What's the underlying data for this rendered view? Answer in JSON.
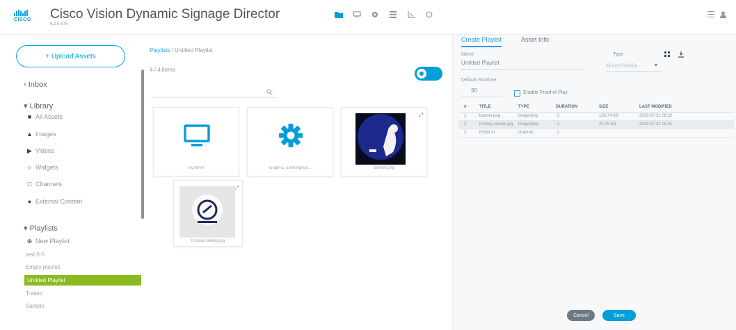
{
  "header": {
    "brand": "CISCO",
    "title": "Cisco Vision Dynamic Signage Director",
    "version": "6.2.0-578",
    "nav_icons": [
      "folder-icon",
      "monitor-icon",
      "gear-icon",
      "list-icon",
      "chart-icon",
      "circle-icon"
    ],
    "right_icons": [
      "menu-icon",
      "user-icon"
    ]
  },
  "sidebar": {
    "upload_label": "+ Upload Assets",
    "inbox": "Inbox",
    "library": "Library",
    "library_items": [
      {
        "icon": "document-icon",
        "label": "All Assets"
      },
      {
        "icon": "image-icon",
        "label": "Images"
      },
      {
        "icon": "video-icon",
        "label": "Videos"
      },
      {
        "icon": "widget-icon",
        "label": "Widgets"
      },
      {
        "icon": "channel-icon",
        "label": "Channels"
      },
      {
        "icon": "external-icon",
        "label": "External Content"
      }
    ],
    "playlists": "Playlists",
    "new_playlist": "New Playlist",
    "playlist_items": [
      "test-5-6",
      "Empty playlist",
      "Untitled Playlist",
      "T-stem",
      "Sample"
    ],
    "active_index": 2
  },
  "middle": {
    "breadcrumb_link": "Playlists",
    "breadcrumb_sep": "/",
    "breadcrumb_current": "Untitled Playlist",
    "count": "4 / 4 items",
    "cards": [
      {
        "caption": "HDMI-In",
        "kind": "monitor"
      },
      {
        "caption": "Graphic_user0riginal...",
        "kind": "gear"
      },
      {
        "caption": "banner.png",
        "kind": "photo"
      },
      {
        "caption": "hockey-sleepe.jpg",
        "kind": "logo"
      }
    ]
  },
  "right": {
    "tabs": [
      "Create Playlist",
      "Asset Info"
    ],
    "active_tab": 0,
    "name_label": "Name",
    "name_value": "Untitled Playlist",
    "type_label": "Type",
    "type_value": "Mixed Media",
    "default_runtime_label": "Default Runtime",
    "default_runtime_value": "30",
    "proof_of_play_label": "Enable Proof of Play",
    "table": {
      "headers": [
        "#",
        "TITLE",
        "TYPE",
        "DURATION",
        "SIZE",
        "LAST MODIFIED"
      ],
      "rows": [
        [
          "1",
          "banner.png",
          "image/png",
          "-1",
          "150.74 KB",
          "2019-07-31 08:22"
        ],
        [
          "2",
          "hockey-sleepe.jpg",
          "image/jpeg",
          "-1",
          "20.79 KB",
          "2019-07-31 09:01"
        ],
        [
          "3",
          "HDMI-In",
          "channel",
          "-1",
          "",
          ""
        ]
      ],
      "highlight_index": 1
    },
    "cancel_label": "Cancel",
    "save_label": "Save"
  }
}
